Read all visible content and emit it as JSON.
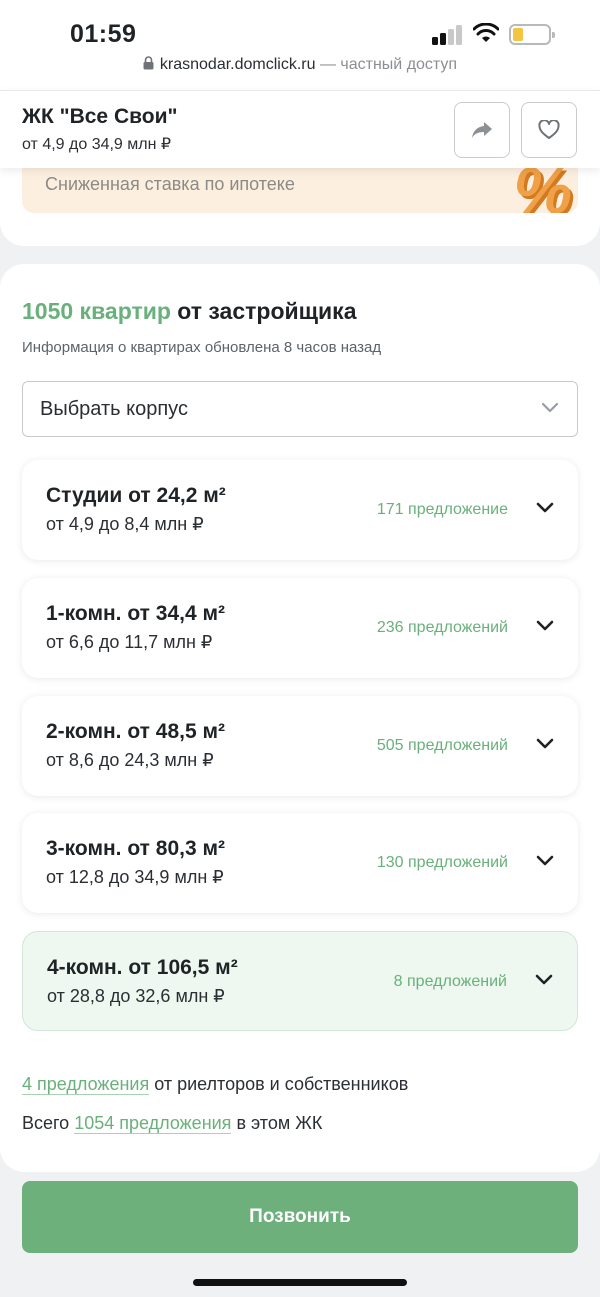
{
  "status_bar": {
    "time": "01:59"
  },
  "url_bar": {
    "domain": "krasnodar.domclick.ru",
    "suffix": " — частный доступ"
  },
  "header": {
    "title": "ЖК \"Все Свои\"",
    "price_range": "от 4,9 до 34,9 млн ₽"
  },
  "promo": {
    "text": "Сниженная ставка по ипотеке",
    "badge": "%"
  },
  "main": {
    "count_highlight": "1050 квартир",
    "title_rest": " от застройщика",
    "updated_note": "Информация о квартирах обновлена 8 часов назад",
    "building_select_label": "Выбрать корпус",
    "flat_types": [
      {
        "title": "Студии от 24,2 м²",
        "price": "от 4,9 до 8,4 млн ₽",
        "offers": "171 предложение"
      },
      {
        "title": "1-комн. от 34,4 м²",
        "price": "от 6,6 до 11,7 млн ₽",
        "offers": "236 предложений"
      },
      {
        "title": "2-комн. от 48,5 м²",
        "price": "от 8,6 до 24,3 млн ₽",
        "offers": "505 предложений"
      },
      {
        "title": "3-комн. от 80,3 м²",
        "price": "от 12,8 до 34,9 млн ₽",
        "offers": "130 предложений"
      },
      {
        "title": "4-комн. от 106,5 м²",
        "price": "от 28,8 до 32,6 млн ₽",
        "offers": "8 предложений"
      }
    ],
    "realtor_link": "4 предложения",
    "realtor_rest": " от риелторов и собственников",
    "total_prefix": "Всего ",
    "total_link": "1054 предложения",
    "total_suffix": " в этом ЖК"
  },
  "cta": {
    "label": "Позвонить"
  },
  "colors": {
    "accent": "#6ab07b",
    "button": "#6db07c",
    "promo_bg": "#fcefdf",
    "active_row_bg": "#eef7f0"
  }
}
